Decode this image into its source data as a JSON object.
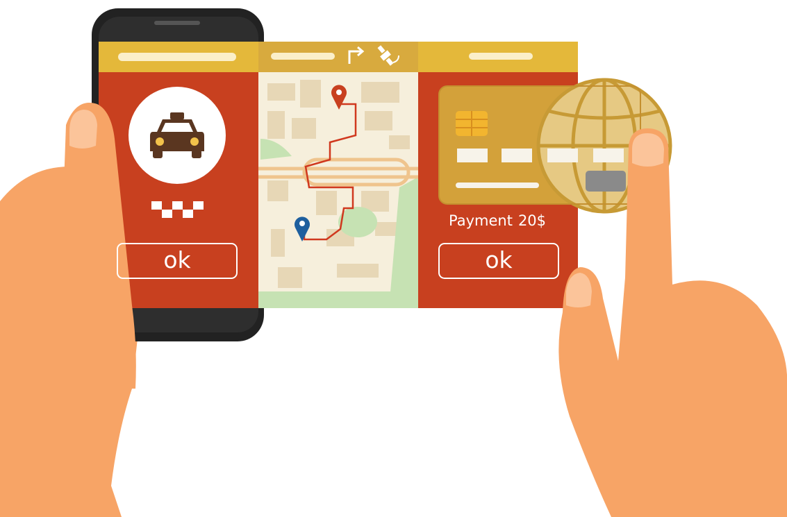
{
  "booking_panel": {
    "ok_label": "ok"
  },
  "payment_panel": {
    "payment_label": "Payment",
    "payment_amount": "20$",
    "ok_label": "ok"
  },
  "colors": {
    "panel_red": "#c8401f",
    "header_yellow": "#e4b83a",
    "map_bg": "#f6efdc",
    "card_gold": "#d3a13a",
    "skin": "#f7a466",
    "phone_black": "#222222",
    "pin_red": "#c8401f",
    "pin_blue": "#1e5f9e"
  },
  "icons": [
    "taxi-icon",
    "checker-icon",
    "turn-arrow-icon",
    "satellite-icon",
    "map-pin-icon",
    "chip-icon",
    "globe-icon"
  ]
}
